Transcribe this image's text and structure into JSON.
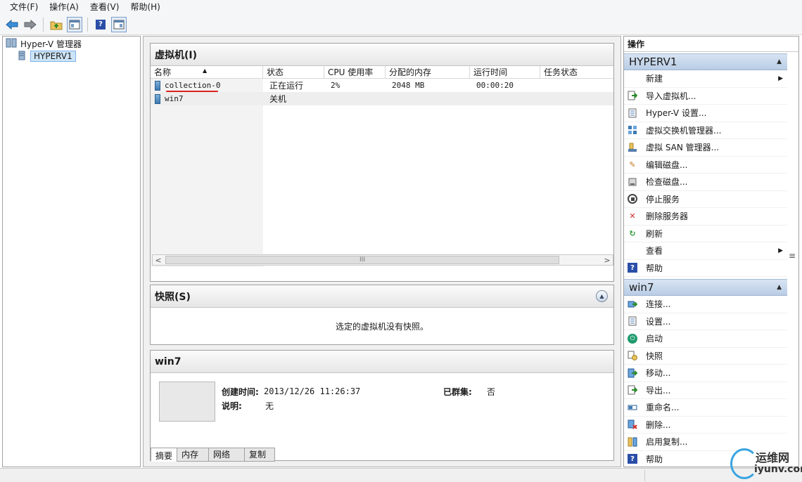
{
  "menu": [
    "文件(F)",
    "操作(A)",
    "查看(V)",
    "帮助(H)"
  ],
  "tree": {
    "root": "Hyper-V 管理器",
    "child": "HYPERV1"
  },
  "vm_panel": {
    "title": "虚拟机(I)",
    "columns": [
      "名称",
      "状态",
      "CPU 使用率",
      "分配的内存",
      "运行时间",
      "任务状态"
    ],
    "rows": [
      {
        "name": "collection-0",
        "status": "正在运行",
        "cpu": "2%",
        "memory": "2048 MB",
        "uptime": "00:00:20",
        "task": ""
      },
      {
        "name": "win7",
        "status": "关机",
        "cpu": "",
        "memory": "",
        "uptime": "",
        "task": ""
      }
    ],
    "scroll_grip": "III"
  },
  "snapshot_panel": {
    "title": "快照(S)",
    "message": "选定的虚拟机没有快照。"
  },
  "detail_panel": {
    "title": "win7",
    "created_label": "创建时间:",
    "created_value": "2013/12/26 11:26:37",
    "desc_label": "说明:",
    "desc_value": "无",
    "cluster_label": "已群集:",
    "cluster_value": "否",
    "tabs": [
      "摘要",
      "内存",
      "网络",
      "复制"
    ]
  },
  "actions": {
    "title": "操作",
    "section1": {
      "name": "HYPERV1",
      "items": [
        "新建",
        "导入虚拟机...",
        "Hyper-V 设置...",
        "虚拟交换机管理器...",
        "虚拟 SAN 管理器...",
        "编辑磁盘...",
        "检查磁盘...",
        "停止服务",
        "删除服务器",
        "刷新",
        "查看",
        "帮助"
      ]
    },
    "section2": {
      "name": "win7",
      "items": [
        "连接...",
        "设置...",
        "启动",
        "快照",
        "移动...",
        "导出...",
        "重命名...",
        "删除...",
        "启用复制...",
        "帮助"
      ]
    }
  },
  "watermark": {
    "line1": "运维网",
    "line2": "iyunv.com"
  }
}
